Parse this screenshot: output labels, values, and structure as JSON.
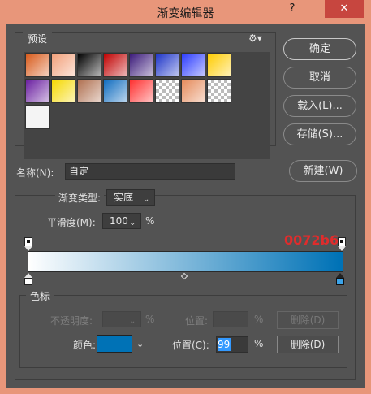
{
  "window": {
    "title": "渐变编辑器",
    "help": "?",
    "close": "✕"
  },
  "presets": {
    "label": "预设",
    "gear_icon": "gear-icon",
    "swatches": [
      [
        "#d85a1a",
        "#f2a07a",
        "#000000",
        "#c00000",
        "#3b1a7a",
        "#1d34c8",
        "#2c3cff",
        "#ffcc00"
      ],
      [
        "#6a1ea0",
        "#f5d800",
        "#b07050",
        "#0f6cbf",
        "#ff2e2e",
        "#e0e0e0",
        "#e58a5a",
        "#cccccc"
      ],
      [
        "#ffffff"
      ]
    ]
  },
  "buttons": {
    "ok": "确定",
    "cancel": "取消",
    "load": "载入(L)...",
    "save": "存储(S)...",
    "new": "新建(W)"
  },
  "name": {
    "label": "名称(N):",
    "value": "自定"
  },
  "gradient": {
    "type_label": "渐变类型:",
    "type_value": "实底",
    "smoothness_label": "平滑度(M):",
    "smoothness_value": "100",
    "smoothness_unit": "%",
    "annotation": "0072b6",
    "start_color": "#ffffff",
    "end_color": "#0072b6",
    "end_location_percent": 99
  },
  "stops": {
    "section_label": "色标",
    "opacity_label": "不透明度:",
    "opacity_unit": "%",
    "opacity_position_label": "位置:",
    "opacity_position_unit": "%",
    "opacity_delete": "删除(D)",
    "color_label": "颜色:",
    "color_value": "#0072b6",
    "color_position_label": "位置(C):",
    "color_position_value": "99",
    "color_position_unit": "%",
    "color_delete": "删除(D)"
  }
}
